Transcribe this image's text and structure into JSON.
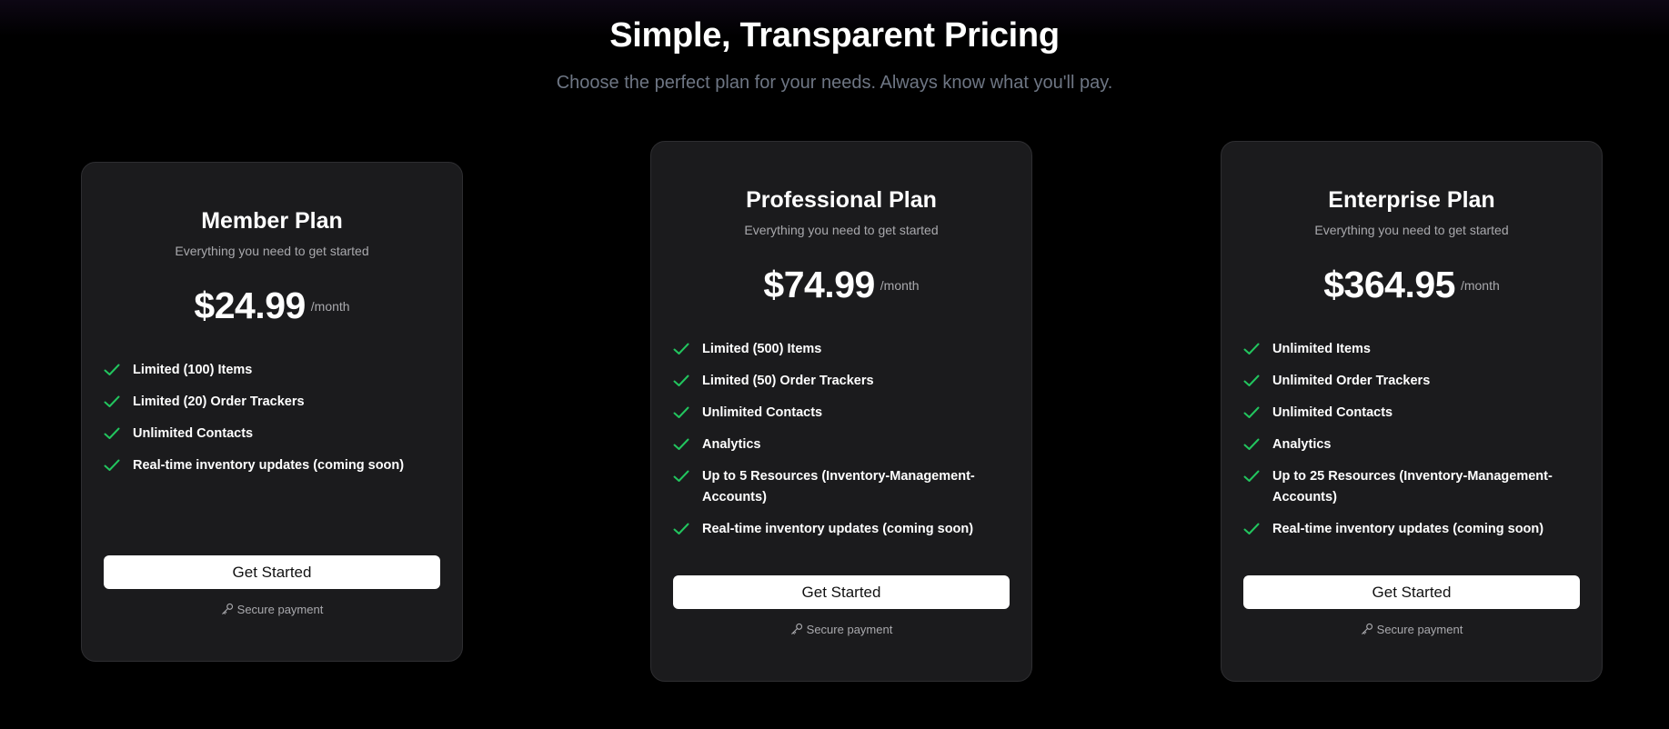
{
  "header": {
    "title": "Simple, Transparent Pricing",
    "subtitle": "Choose the perfect plan for your needs. Always know what you'll pay."
  },
  "colors": {
    "background": "#000000",
    "card": "#1b1b1d",
    "check": "#22c55e",
    "button": "#ffffff"
  },
  "plans": [
    {
      "name": "Member Plan",
      "description": "Everything you need to get started",
      "price": "$24.99",
      "period": "/month",
      "features": [
        "Limited (100) Items",
        "Limited (20) Order Trackers",
        "Unlimited Contacts",
        "Real-time inventory updates (coming soon)"
      ],
      "cta": "Get Started",
      "secure": "Secure payment"
    },
    {
      "name": "Professional Plan",
      "description": "Everything you need to get started",
      "price": "$74.99",
      "period": "/month",
      "features": [
        "Limited (500) Items",
        "Limited (50) Order Trackers",
        "Unlimited Contacts",
        "Analytics",
        "Up to 5 Resources (Inventory-Management-Accounts)",
        "Real-time inventory updates (coming soon)"
      ],
      "cta": "Get Started",
      "secure": "Secure payment"
    },
    {
      "name": "Enterprise Plan",
      "description": "Everything you need to get started",
      "price": "$364.95",
      "period": "/month",
      "features": [
        "Unlimited Items",
        "Unlimited Order Trackers",
        "Unlimited Contacts",
        "Analytics",
        "Up to 25 Resources (Inventory-Management-Accounts)",
        "Real-time inventory updates (coming soon)"
      ],
      "cta": "Get Started",
      "secure": "Secure payment"
    }
  ],
  "icons": {
    "feature": "check-icon",
    "secure": "key-icon"
  }
}
